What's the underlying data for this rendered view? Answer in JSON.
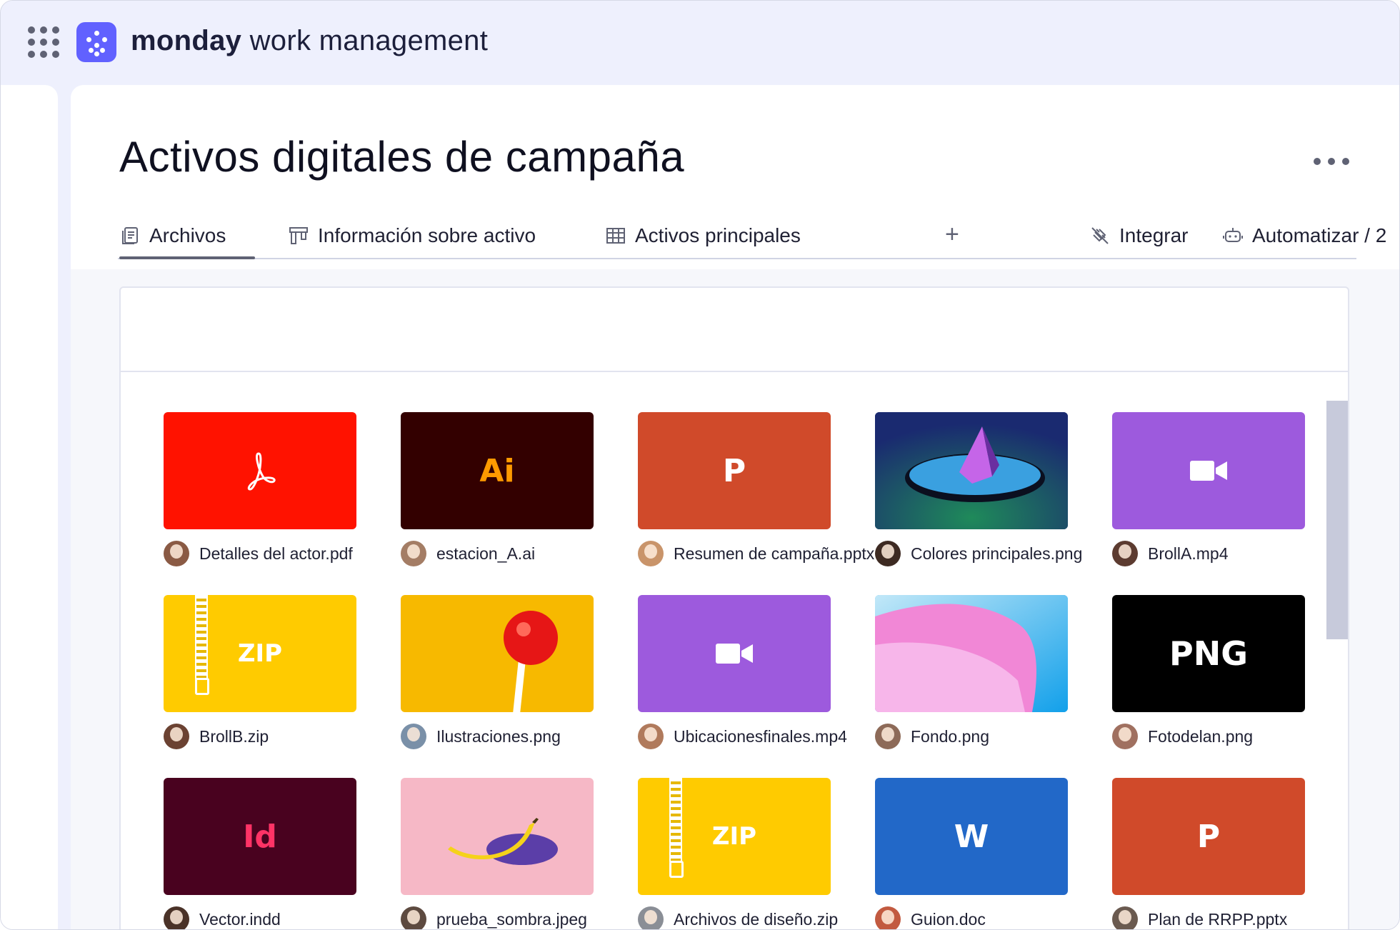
{
  "app": {
    "brand_bold": "monday",
    "brand_rest": " work management"
  },
  "page": {
    "title": "Activos digitales de campaña"
  },
  "tabs": [
    {
      "label": "Archivos",
      "icon": "files-icon"
    },
    {
      "label": "Información sobre activo",
      "icon": "kanban-icon"
    },
    {
      "label": "Activos principales",
      "icon": "table-icon"
    }
  ],
  "toolbar": {
    "add": "+",
    "integrate": "Integrar",
    "automate": "Automatizar / 2"
  },
  "files": [
    {
      "name": "Detalles del actor.pdf",
      "thumb": "pdf",
      "bg": "#ff1200",
      "label": "",
      "color": "#ffffff",
      "avatar": "#8a5a44"
    },
    {
      "name": "estacion_A.ai",
      "thumb": "text",
      "bg": "#330000",
      "label": "Ai",
      "color": "#ff9a00",
      "avatar": "#a47d65"
    },
    {
      "name": "Resumen de campaña.pptx",
      "thumb": "text",
      "bg": "#d04a2a",
      "label": "P",
      "color": "#ffffff",
      "avatar": "#c9946a"
    },
    {
      "name": "Colores principales.png",
      "thumb": "crystal",
      "bg": "#1a3470",
      "label": "",
      "color": "#ffffff",
      "avatar": "#3d2a22"
    },
    {
      "name": "BrollA.mp4",
      "thumb": "video",
      "bg": "#9d5add",
      "label": "",
      "color": "#ffffff",
      "avatar": "#5c3b30"
    },
    {
      "name": "BrollB.zip",
      "thumb": "zip",
      "bg": "#ffcb00",
      "label": "ZIP",
      "color": "#ffffff",
      "avatar": "#6b4232"
    },
    {
      "name": "Ilustraciones.png",
      "thumb": "lollipop",
      "bg": "#f7b900",
      "label": "",
      "color": "#ffffff",
      "avatar": "#7a90a8"
    },
    {
      "name": "Ubicacionesfinales.mp4",
      "thumb": "video",
      "bg": "#9d5add",
      "label": "",
      "color": "#ffffff",
      "avatar": "#b07a5c"
    },
    {
      "name": "Fondo.png",
      "thumb": "wave",
      "bg": "#1fa4ec",
      "label": "",
      "color": "#ffffff",
      "avatar": "#8d6a58"
    },
    {
      "name": "Fotodelan.png",
      "thumb": "text",
      "bg": "#000000",
      "label": "PNG",
      "color": "#ffffff",
      "avatar": "#a07060"
    },
    {
      "name": "Vector.indd",
      "thumb": "text",
      "bg": "#49021f",
      "label": "Id",
      "color": "#ff3366",
      "avatar": "#4a3228"
    },
    {
      "name": "prueba_sombra.jpeg",
      "thumb": "banana",
      "bg": "#f6b8c6",
      "label": "",
      "color": "#ffffff",
      "avatar": "#5d4a40"
    },
    {
      "name": "Archivos de diseño.zip",
      "thumb": "zip",
      "bg": "#ffcb00",
      "label": "ZIP",
      "color": "#ffffff",
      "avatar": "#8a8e96"
    },
    {
      "name": "Guion.doc",
      "thumb": "text",
      "bg": "#2268c8",
      "label": "W",
      "color": "#ffffff",
      "avatar": "#c25a40"
    },
    {
      "name": "Plan de RRPP.pptx",
      "thumb": "text",
      "bg": "#d04a2a",
      "label": "P",
      "color": "#ffffff",
      "avatar": "#6a5a50"
    }
  ]
}
